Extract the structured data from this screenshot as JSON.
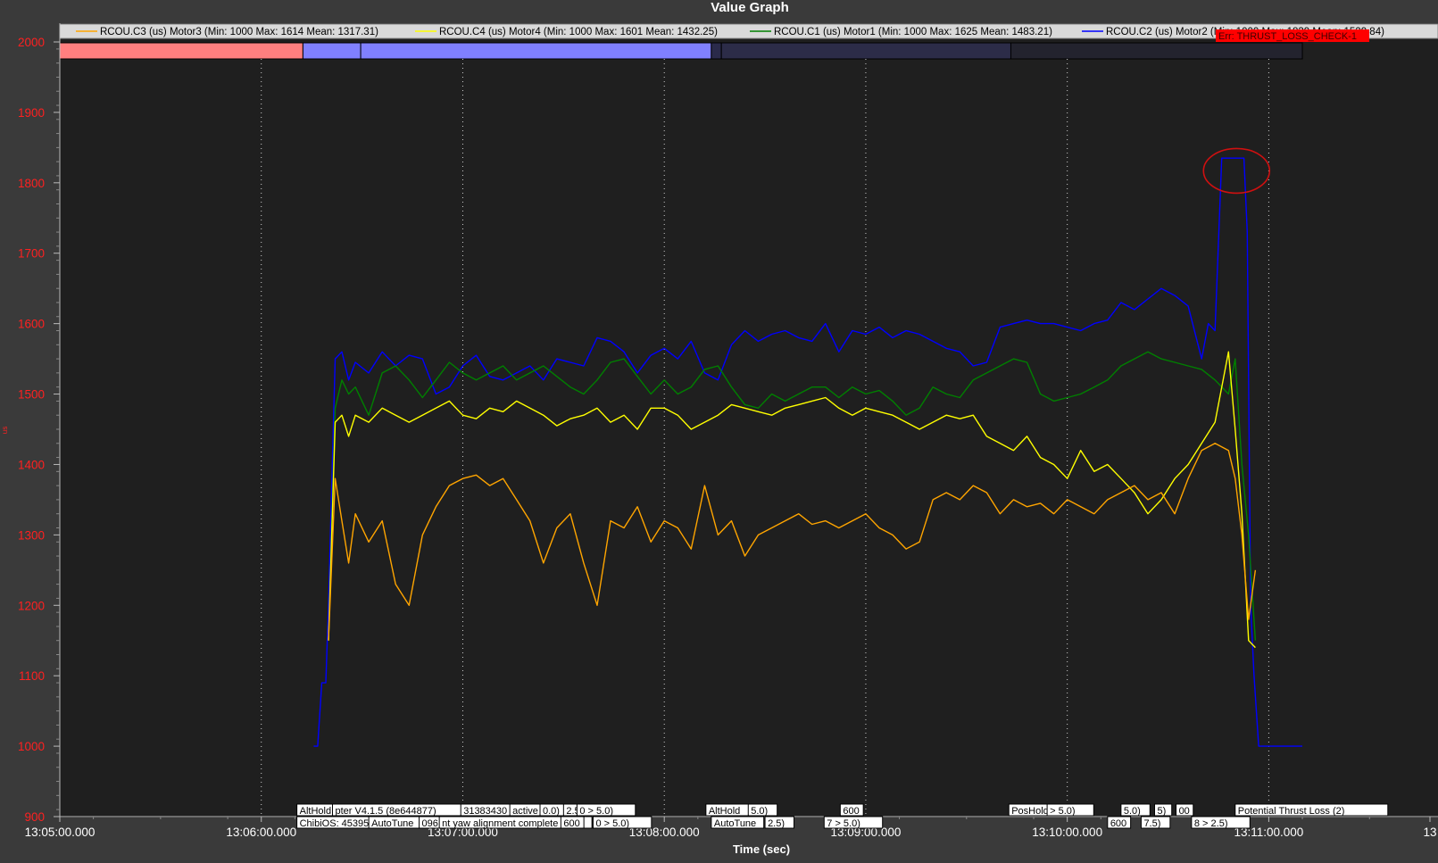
{
  "chart_data": {
    "type": "line",
    "title": "Value Graph",
    "xlabel": "Time (sec)",
    "ylabel": "us",
    "ylim": [
      900,
      2000
    ],
    "xlim_seconds_of_13h": [
      300,
      480
    ],
    "x_ticks": [
      {
        "t": 300,
        "label": "13:05:00.000"
      },
      {
        "t": 330,
        "label": "13:06:00.000"
      },
      {
        "t": 360,
        "label": "13:07:00.000"
      },
      {
        "t": 390,
        "label": "13:08:00.000"
      },
      {
        "t": 420,
        "label": "13:09:00.000"
      },
      {
        "t": 450,
        "label": "13:10:00.000"
      },
      {
        "t": 480,
        "label": "13:11:00.000"
      },
      {
        "t": 504,
        "label": "13"
      }
    ],
    "y_ticks": [
      900,
      1000,
      1100,
      1200,
      1300,
      1400,
      1500,
      1600,
      1700,
      1800,
      1900,
      2000
    ],
    "grid": "vertical dotted",
    "legend_position": "top",
    "legend": [
      {
        "label": "RCOU.C3 (us) Motor3 (Min: 1000 Max: 1614 Mean: 1317.31)",
        "color": "#ffa500"
      },
      {
        "label": "RCOU.C4 (us) Motor4 (Min: 1000 Max: 1601 Mean: 1432.25)",
        "color": "#ffff00"
      },
      {
        "label": "RCOU.C1 (us) Motor1 (Min: 1000 Max: 1625 Mean: 1483.21)",
        "color": "#008000"
      },
      {
        "label": "RCOU.C2 (us) Motor2 (Min: 1000 Max: 1839 Mean: 1529.84)",
        "color": "#0000ff"
      }
    ],
    "series": [
      {
        "name": "RCOU.C2 (us) Motor2",
        "color": "#0000ff",
        "x": [
          337.8,
          338.4,
          339.0,
          339.6,
          340.0,
          341,
          342,
          343,
          344,
          346,
          348,
          350,
          352,
          354,
          356,
          358,
          360,
          362,
          364,
          366,
          368,
          370,
          372,
          374,
          376,
          378,
          380,
          382,
          384,
          386,
          388,
          390,
          392,
          394,
          396,
          398,
          400,
          402,
          404,
          406,
          408,
          410,
          412,
          414,
          416,
          418,
          420,
          422,
          424,
          426,
          428,
          430,
          432,
          434,
          436,
          438,
          440,
          442,
          444,
          446,
          448,
          450,
          452,
          454,
          456,
          458,
          460,
          462,
          464,
          466,
          468,
          470,
          471,
          472,
          473,
          474,
          475,
          475.8,
          476.3,
          476.8,
          477.3,
          477.8,
          478.5,
          479,
          485
        ],
        "values": [
          1000,
          1000,
          1090,
          1090,
          1200,
          1550,
          1560,
          1520,
          1545,
          1530,
          1560,
          1540,
          1555,
          1550,
          1500,
          1510,
          1540,
          1555,
          1525,
          1520,
          1530,
          1540,
          1520,
          1550,
          1545,
          1540,
          1580,
          1575,
          1560,
          1530,
          1555,
          1565,
          1550,
          1575,
          1530,
          1520,
          1570,
          1590,
          1575,
          1585,
          1590,
          1580,
          1575,
          1600,
          1560,
          1590,
          1585,
          1595,
          1580,
          1590,
          1585,
          1575,
          1565,
          1560,
          1540,
          1545,
          1595,
          1600,
          1605,
          1600,
          1600,
          1595,
          1590,
          1600,
          1605,
          1630,
          1620,
          1635,
          1650,
          1640,
          1625,
          1550,
          1600,
          1590,
          1835,
          1835,
          1835,
          1835,
          1835,
          1730,
          1200,
          1100,
          1000,
          1000,
          1000
        ]
      },
      {
        "name": "RCOU.C1 (us) Motor1",
        "color": "#008000",
        "x": [
          340,
          341,
          342,
          343,
          344,
          346,
          348,
          350,
          352,
          354,
          356,
          358,
          360,
          362,
          364,
          366,
          368,
          370,
          372,
          374,
          376,
          378,
          380,
          382,
          384,
          386,
          388,
          390,
          392,
          394,
          396,
          398,
          400,
          402,
          404,
          406,
          408,
          410,
          412,
          414,
          416,
          418,
          420,
          422,
          424,
          426,
          428,
          430,
          432,
          434,
          436,
          438,
          440,
          442,
          444,
          446,
          448,
          450,
          452,
          454,
          456,
          458,
          460,
          462,
          464,
          466,
          468,
          470,
          472,
          474,
          475,
          476,
          477,
          478
        ],
        "values": [
          1150,
          1480,
          1520,
          1500,
          1510,
          1470,
          1530,
          1540,
          1520,
          1495,
          1520,
          1545,
          1530,
          1520,
          1530,
          1540,
          1520,
          1530,
          1540,
          1525,
          1510,
          1500,
          1520,
          1545,
          1550,
          1525,
          1500,
          1520,
          1500,
          1510,
          1535,
          1540,
          1510,
          1485,
          1480,
          1500,
          1490,
          1500,
          1510,
          1510,
          1495,
          1510,
          1500,
          1505,
          1490,
          1470,
          1480,
          1510,
          1500,
          1495,
          1520,
          1530,
          1540,
          1550,
          1545,
          1500,
          1490,
          1495,
          1500,
          1510,
          1520,
          1540,
          1550,
          1560,
          1550,
          1545,
          1540,
          1535,
          1520,
          1500,
          1550,
          1400,
          1300,
          1150
        ]
      },
      {
        "name": "RCOU.C4 (us) Motor4",
        "color": "#ffff00",
        "x": [
          340,
          341,
          342,
          343,
          344,
          346,
          348,
          350,
          352,
          354,
          356,
          358,
          360,
          362,
          364,
          366,
          368,
          370,
          372,
          374,
          376,
          378,
          380,
          382,
          384,
          386,
          388,
          390,
          392,
          394,
          396,
          398,
          400,
          402,
          404,
          406,
          408,
          410,
          412,
          414,
          416,
          418,
          420,
          422,
          424,
          426,
          428,
          430,
          432,
          434,
          436,
          438,
          440,
          442,
          444,
          446,
          448,
          450,
          452,
          454,
          456,
          458,
          460,
          462,
          464,
          466,
          468,
          470,
          472,
          474,
          475,
          476,
          477,
          478
        ],
        "values": [
          1150,
          1460,
          1470,
          1440,
          1470,
          1460,
          1480,
          1470,
          1460,
          1470,
          1480,
          1490,
          1470,
          1465,
          1480,
          1475,
          1490,
          1480,
          1470,
          1455,
          1465,
          1470,
          1480,
          1460,
          1470,
          1450,
          1480,
          1480,
          1470,
          1450,
          1460,
          1470,
          1485,
          1480,
          1475,
          1470,
          1480,
          1485,
          1490,
          1495,
          1480,
          1470,
          1480,
          1475,
          1470,
          1460,
          1450,
          1460,
          1470,
          1465,
          1470,
          1440,
          1430,
          1420,
          1440,
          1410,
          1400,
          1380,
          1420,
          1390,
          1400,
          1380,
          1360,
          1330,
          1350,
          1380,
          1400,
          1430,
          1460,
          1560,
          1450,
          1330,
          1150,
          1140
        ]
      },
      {
        "name": "RCOU.C3 (us) Motor3",
        "color": "#ffa500",
        "x": [
          340,
          341,
          342,
          343,
          344,
          346,
          348,
          350,
          352,
          354,
          356,
          358,
          360,
          362,
          364,
          366,
          368,
          370,
          372,
          374,
          376,
          378,
          380,
          382,
          384,
          386,
          388,
          390,
          392,
          394,
          396,
          398,
          400,
          402,
          404,
          406,
          408,
          410,
          412,
          414,
          416,
          418,
          420,
          422,
          424,
          426,
          428,
          430,
          432,
          434,
          436,
          438,
          440,
          442,
          444,
          446,
          448,
          450,
          452,
          454,
          456,
          458,
          460,
          462,
          464,
          466,
          468,
          470,
          472,
          474,
          475,
          476,
          477,
          478
        ],
        "values": [
          1150,
          1380,
          1320,
          1260,
          1330,
          1290,
          1320,
          1230,
          1200,
          1300,
          1340,
          1370,
          1380,
          1385,
          1370,
          1380,
          1350,
          1320,
          1260,
          1310,
          1330,
          1260,
          1200,
          1320,
          1310,
          1340,
          1290,
          1320,
          1310,
          1280,
          1370,
          1300,
          1320,
          1270,
          1300,
          1310,
          1320,
          1330,
          1315,
          1320,
          1310,
          1320,
          1330,
          1310,
          1300,
          1280,
          1290,
          1350,
          1360,
          1350,
          1370,
          1360,
          1330,
          1350,
          1340,
          1345,
          1330,
          1350,
          1340,
          1330,
          1350,
          1360,
          1370,
          1350,
          1360,
          1330,
          1380,
          1420,
          1430,
          1420,
          1380,
          1300,
          1180,
          1250
        ]
      }
    ],
    "mode_bar": [
      {
        "start": 300,
        "end": 336.2,
        "color": "#ff7f7f"
      },
      {
        "start": 336.2,
        "end": 344.8,
        "color": "#8080ff"
      },
      {
        "start": 344.8,
        "end": 397.0,
        "color": "#8080ff"
      },
      {
        "start": 397.0,
        "end": 398.5,
        "color": "#2a2a4a"
      },
      {
        "start": 398.5,
        "end": 441.6,
        "color": "#2c2c48"
      },
      {
        "start": 441.6,
        "end": 485.0,
        "color": "#23232e"
      }
    ],
    "error_label": "Err: THRUST_LOSS_CHECK-1",
    "event_labels_row1": [
      {
        "t": 335.3,
        "text": "AltHold"
      },
      {
        "t": 340.6,
        "text": "pter V4.1.5 (8e644877)"
      },
      {
        "t": 359.7,
        "text": "31383430"
      },
      {
        "t": 367.0,
        "text": "active"
      },
      {
        "t": 371.5,
        "text": "0.0)"
      },
      {
        "t": 375.0,
        "text": "2.5)"
      },
      {
        "t": 377.0,
        "text": "0 >  5.0)"
      },
      {
        "t": 396.2,
        "text": "AltHold"
      },
      {
        "t": 402.5,
        "text": "5.0)"
      },
      {
        "t": 416.2,
        "text": "600"
      },
      {
        "t": 441.3,
        "text": "PosHold"
      },
      {
        "t": 447.0,
        "text": ">  5.0)"
      },
      {
        "t": 458.0,
        "text": "5.0)"
      },
      {
        "t": 463.0,
        "text": "5)"
      },
      {
        "t": 466.2,
        "text": "00"
      },
      {
        "t": 475.0,
        "text": "Potential Thrust Loss (2)"
      }
    ],
    "event_labels_row2": [
      {
        "t": 335.3,
        "text": "ChibiOS: 45395b"
      },
      {
        "t": 346.0,
        "text": "AutoTune"
      },
      {
        "t": 353.5,
        "text": "096"
      },
      {
        "t": 356.5,
        "text": "nt yaw alignment complete"
      },
      {
        "t": 374.6,
        "text": "600"
      },
      {
        "t": 379.4,
        "text": "0 >  5.0)"
      },
      {
        "t": 397.0,
        "text": "AutoTune"
      },
      {
        "t": 405.0,
        "text": "2.5)"
      },
      {
        "t": 413.8,
        "text": "7 >  5.0)"
      },
      {
        "t": 456.0,
        "text": "600"
      },
      {
        "t": 461.0,
        "text": "7.5)"
      },
      {
        "t": 468.5,
        "text": "8 >  2.5)"
      }
    ]
  }
}
